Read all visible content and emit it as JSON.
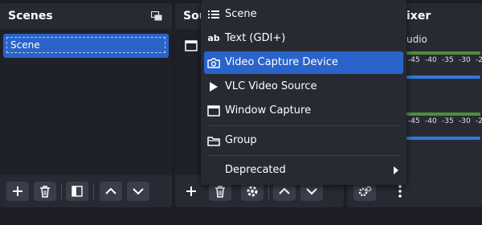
{
  "scenes": {
    "title": "Scenes",
    "items": [
      "Scene"
    ]
  },
  "sources": {
    "title": "Sou"
  },
  "mixer": {
    "title": "ixer",
    "line_name": "udio",
    "ticks": [
      "-45",
      "-40",
      "-35",
      "-30",
      "-2"
    ]
  },
  "context_menu": {
    "items": [
      {
        "label": "Scene",
        "icon": "list-icon"
      },
      {
        "label": "Text (GDI+)",
        "icon": "text-ab-icon"
      },
      {
        "label": "Video Capture Device",
        "icon": "camera-icon",
        "active": true
      },
      {
        "label": "VLC Video Source",
        "icon": "play-icon"
      },
      {
        "label": "Window Capture",
        "icon": "window-icon"
      },
      {
        "label": "Group",
        "icon": "folder-icon"
      },
      {
        "label": "Deprecated",
        "has_submenu": true
      }
    ]
  },
  "colors": {
    "accent": "#2a63c9",
    "meter_green": "#4c8f34",
    "meter_blue": "#2f7ad6"
  }
}
